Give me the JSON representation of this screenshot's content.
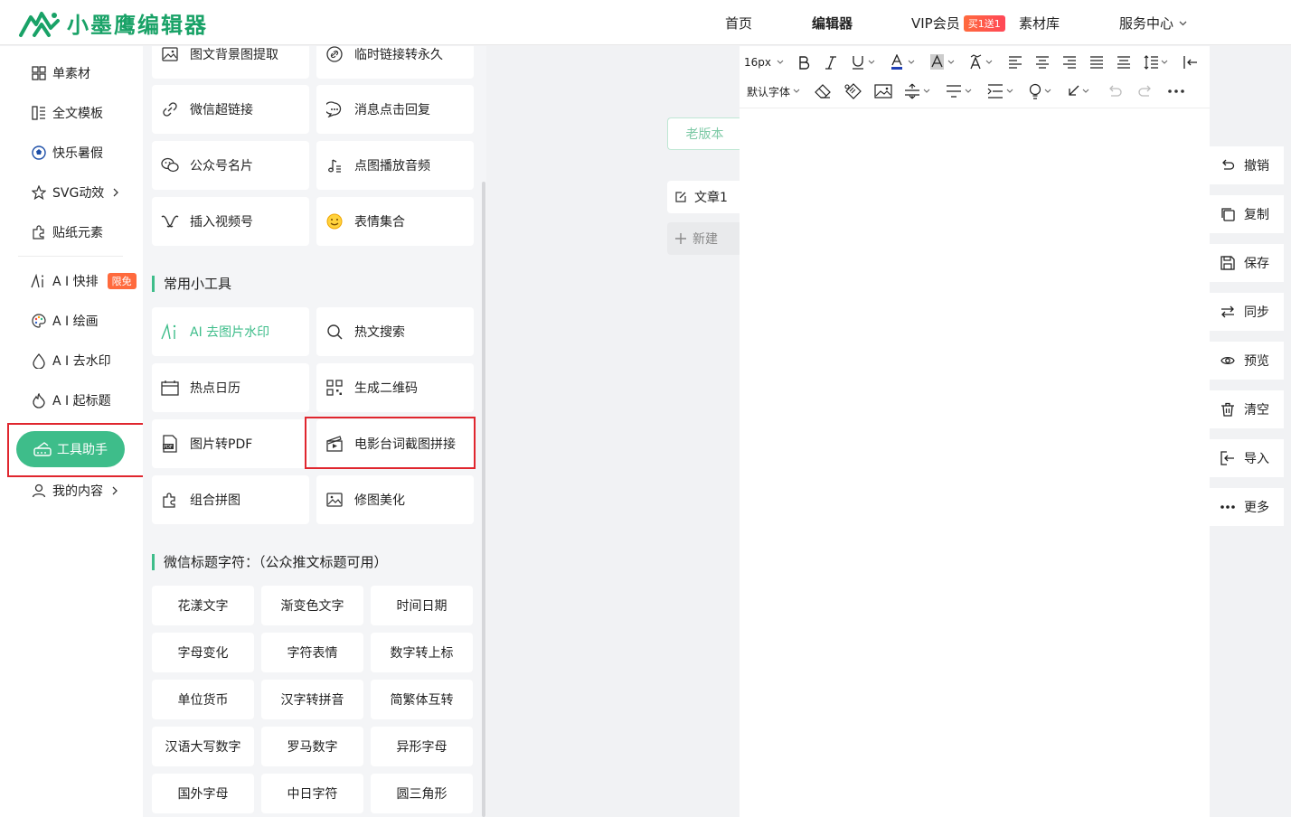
{
  "header": {
    "logo_text": "小墨鹰编辑器",
    "nav": {
      "home": "首页",
      "editor": "编辑器",
      "vip": "VIP会员",
      "vip_badge": "买1送1",
      "materials": "素材库",
      "service": "服务中心"
    },
    "brand_color": "#19a267"
  },
  "sidebar": {
    "items": {
      "single_material": "单素材",
      "full_template": "全文模板",
      "happy_summer": "快乐暑假",
      "svg_animation": "SVG动效",
      "stickers": "贴纸元素",
      "ai_layout": "A I 快排",
      "ai_layout_badge": "限免",
      "ai_draw": "A I 绘画",
      "ai_watermark": "A I 去水印",
      "ai_title": "A I 起标题",
      "tool_helper": "工具助手",
      "my_content": "我的内容"
    },
    "accent_color": "#3ebd8a"
  },
  "tools": {
    "top_cards": [
      {
        "label": "图文背景图提取",
        "icon": "image-icon"
      },
      {
        "label": "临时链接转永久",
        "icon": "link-circle-icon"
      },
      {
        "label": "微信超链接",
        "icon": "link-icon"
      },
      {
        "label": "消息点击回复",
        "icon": "chat-bubble-icon"
      },
      {
        "label": "公众号名片",
        "icon": "wechat-icon"
      },
      {
        "label": "点图播放音频",
        "icon": "music-note-icon"
      },
      {
        "label": "插入视频号",
        "icon": "video-channel-icon"
      },
      {
        "label": "表情集合",
        "icon": "smile-icon"
      }
    ],
    "section_common": "常用小工具",
    "common_cards": [
      {
        "label": "AI 去图片水印",
        "icon": "ai-icon"
      },
      {
        "label": "热文搜索",
        "icon": "search-icon"
      },
      {
        "label": "热点日历",
        "icon": "calendar-icon"
      },
      {
        "label": "生成二维码",
        "icon": "qrcode-icon"
      },
      {
        "label": "图片转PDF",
        "icon": "pdf-icon"
      },
      {
        "label": "电影台词截图拼接",
        "icon": "film-icon"
      },
      {
        "label": "组合拼图",
        "icon": "puzzle-icon"
      },
      {
        "label": "修图美化",
        "icon": "photo-edit-icon"
      }
    ],
    "section_wechat": "微信标题字符：（公众推文标题可用）",
    "char_cards": [
      "花漾文字",
      "渐变色文字",
      "时间日期",
      "字母变化",
      "字符表情",
      "数字转上标",
      "单位货币",
      "汉字转拼音",
      "简繁体互转",
      "汉语大写数字",
      "罗马数字",
      "异形字母",
      "国外字母",
      "中日字符",
      "圆三角形"
    ]
  },
  "middle": {
    "old_version": "老版本",
    "article_tab": "文章1",
    "new_tab": "新建"
  },
  "editor": {
    "font_size": "16px",
    "font_family": "默认字体"
  },
  "actions": {
    "undo": "撤销",
    "copy": "复制",
    "save": "保存",
    "sync": "同步",
    "preview": "预览",
    "clear": "清空",
    "import": "导入",
    "more": "更多"
  }
}
